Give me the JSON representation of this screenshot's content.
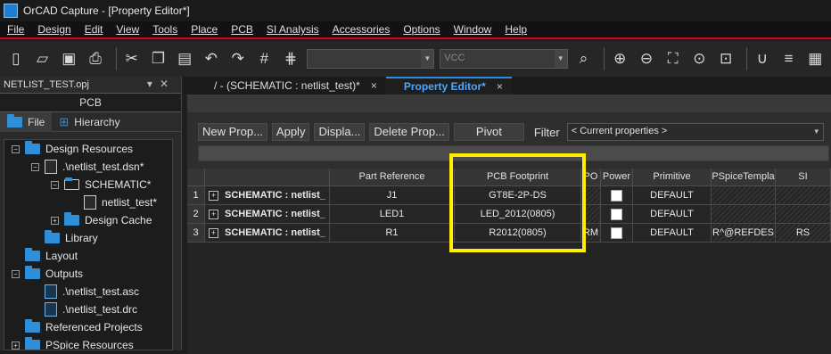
{
  "window": {
    "title": "OrCAD Capture - [Property Editor*]"
  },
  "menu": [
    "File",
    "Design",
    "Edit",
    "View",
    "Tools",
    "Place",
    "PCB",
    "SI Analysis",
    "Accessories",
    "Options",
    "Window",
    "Help"
  ],
  "toolbar": {
    "icons": [
      "new-icon",
      "open-icon",
      "save-icon",
      "print-icon",
      "cut-icon",
      "copy-icon",
      "paste-icon",
      "undo-icon",
      "redo-icon",
      "grid-icon",
      "net-icon"
    ],
    "part_combo_value": "",
    "net_combo_placeholder": "VCC",
    "right_icons": [
      "search-icon",
      "zoom-in-icon",
      "zoom-out-icon",
      "zoom-area-icon",
      "zoom-all-icon",
      "zoom-select-icon",
      "magnet-icon",
      "align-icon",
      "layout-icon"
    ]
  },
  "project": {
    "file_tab": "NETLIST_TEST.opj",
    "panel_title": "PCB",
    "tabs": [
      "File",
      "Hierarchy"
    ],
    "tree": [
      {
        "label": "Design Resources",
        "indent": 0,
        "type": "folder",
        "expand": "-"
      },
      {
        "label": ".\\netlist_test.dsn*",
        "indent": 1,
        "type": "doc",
        "expand": "-"
      },
      {
        "label": "SCHEMATIC*",
        "indent": 2,
        "type": "openfolder",
        "expand": "-"
      },
      {
        "label": "netlist_test*",
        "indent": 3,
        "type": "doc",
        "expand": ""
      },
      {
        "label": "Design Cache",
        "indent": 2,
        "type": "folder",
        "expand": "+"
      },
      {
        "label": "Library",
        "indent": 1,
        "type": "folder",
        "expand": ""
      },
      {
        "label": "Layout",
        "indent": 0,
        "type": "folder",
        "expand": ""
      },
      {
        "label": "Outputs",
        "indent": 0,
        "type": "folder",
        "expand": "-"
      },
      {
        "label": ".\\netlist_test.asc",
        "indent": 1,
        "type": "bluedoc",
        "expand": ""
      },
      {
        "label": ".\\netlist_test.drc",
        "indent": 1,
        "type": "bluedoc",
        "expand": ""
      },
      {
        "label": "Referenced Projects",
        "indent": 0,
        "type": "folder",
        "expand": ""
      },
      {
        "label": "PSpice Resources",
        "indent": 0,
        "type": "folder",
        "expand": "+"
      }
    ]
  },
  "doc_tabs": [
    {
      "label": "/ - (SCHEMATIC : netlist_test)*",
      "close": "×",
      "active": false
    },
    {
      "label": "Property Editor*",
      "close": "×",
      "active": true
    }
  ],
  "property_editor": {
    "buttons": [
      "New Prop...",
      "Apply",
      "Displa...",
      "Delete Prop...",
      "Pivot"
    ],
    "filter_label": "Filter",
    "filter_value": "< Current properties >",
    "columns": [
      "",
      "Part Reference",
      "PCB Footprint",
      "PO",
      "Power",
      "Primitive",
      "PSpiceTempla",
      "SI"
    ],
    "rows": [
      {
        "num": "1",
        "name": "SCHEMATIC : netlist_",
        "ref": "J1",
        "footprint": "GT8E-2P-DS",
        "po": "",
        "primitive": "DEFAULT",
        "pspice": "",
        "si": ""
      },
      {
        "num": "2",
        "name": "SCHEMATIC : netlist_",
        "ref": "LED1",
        "footprint": "LED_2012(0805)",
        "po": "",
        "primitive": "DEFAULT",
        "pspice": "",
        "si": ""
      },
      {
        "num": "3",
        "name": "SCHEMATIC : netlist_",
        "ref": "R1",
        "footprint": "R2012(0805)",
        "po": "RM",
        "primitive": "DEFAULT",
        "pspice": "R^@REFDES",
        "si": "RS"
      }
    ]
  },
  "colors": {
    "accent": "#d9001b",
    "highlight": "#ffee00",
    "tab_active": "#4aa8ff"
  }
}
